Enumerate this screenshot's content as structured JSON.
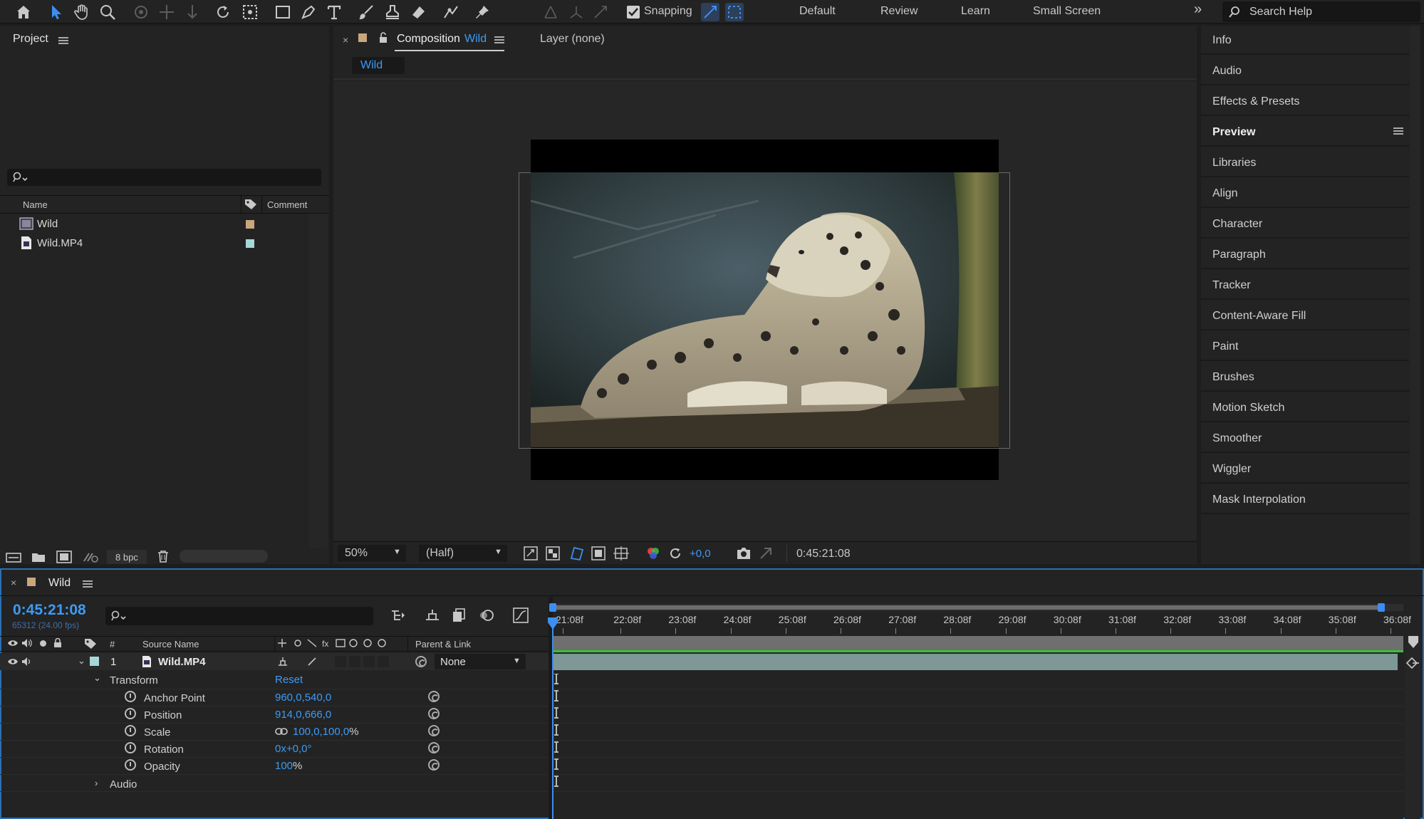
{
  "toolbar": {
    "tools": [
      "home-icon",
      "selection-tool-icon",
      "hand-tool-icon",
      "zoom-tool-icon",
      "orbit-camera-icon",
      "pan-camera-icon",
      "dolly-camera-icon",
      "rotation-tool-icon",
      "pan-behind-icon",
      "rectangle-tool-icon",
      "pen-tool-icon",
      "type-tool-icon",
      "brush-tool-icon",
      "clone-stamp-icon",
      "eraser-tool-icon",
      "roto-brush-icon",
      "puppet-pin-icon"
    ],
    "snapping_label": "Snapping",
    "workspaces": [
      "Default",
      "Review",
      "Learn",
      "Small Screen"
    ],
    "search_placeholder": "Search Help"
  },
  "project": {
    "title": "Project",
    "columns": {
      "name": "Name",
      "comment": "Comment"
    },
    "items": [
      {
        "name": "Wild",
        "type": "composition",
        "label_color": "#c9a77c"
      },
      {
        "name": "Wild.MP4",
        "type": "footage",
        "label_color": "#a6d8d8"
      }
    ],
    "bpc": "8 bpc"
  },
  "composition": {
    "tab_title": "Composition",
    "tab_name": "Wild",
    "layer_tab": "Layer (none)",
    "breadcrumb": "Wild",
    "zoom": "50%",
    "resolution": "(Half)",
    "exposure": "+0,0",
    "timecode": "0:45:21:08"
  },
  "right_panel": {
    "items": [
      "Info",
      "Audio",
      "Effects & Presets",
      "Preview",
      "Libraries",
      "Align",
      "Character",
      "Paragraph",
      "Tracker",
      "Content-Aware Fill",
      "Paint",
      "Brushes",
      "Motion Sketch",
      "Smoother",
      "Wiggler",
      "Mask Interpolation"
    ],
    "active": "Preview"
  },
  "timeline": {
    "title": "Wild",
    "timecode": "0:45:21:08",
    "frame_info": "65312 (24.00 fps)",
    "col_number": "#",
    "col_source": "Source Name",
    "col_parent": "Parent & Link",
    "ruler": [
      "21:08f",
      "22:08f",
      "23:08f",
      "24:08f",
      "25:08f",
      "26:08f",
      "27:08f",
      "28:08f",
      "29:08f",
      "30:08f",
      "31:08f",
      "32:08f",
      "33:08f",
      "34:08f",
      "35:08f",
      "36:08f"
    ],
    "layer": {
      "number": "1",
      "name": "Wild.MP4",
      "parent": "None",
      "label_color": "#a6d8d8"
    },
    "transform": {
      "label": "Transform",
      "reset": "Reset",
      "properties": [
        {
          "name": "Anchor Point",
          "value": "960,0,540,0"
        },
        {
          "name": "Position",
          "value": "914,0,666,0"
        },
        {
          "name": "Scale",
          "value": "100,0,100,0",
          "unit": "%"
        },
        {
          "name": "Rotation",
          "value": "0x+0,0°"
        },
        {
          "name": "Opacity",
          "value": "100",
          "unit": "%"
        }
      ]
    },
    "audio_label": "Audio"
  }
}
